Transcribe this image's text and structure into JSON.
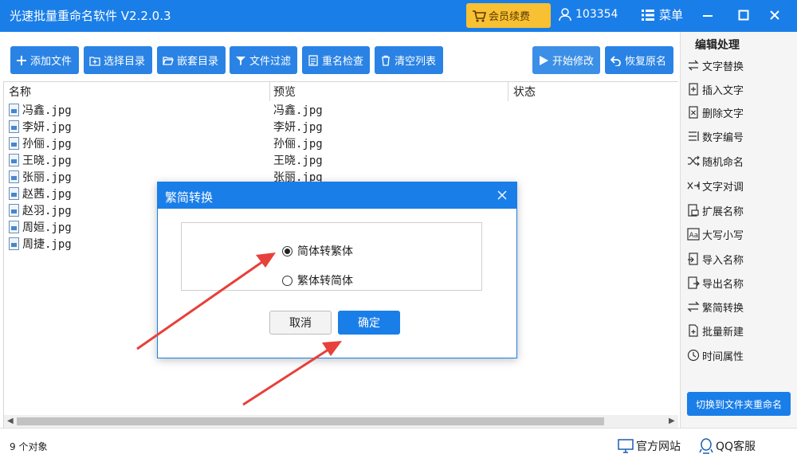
{
  "app": {
    "title": "光速批量重命名软件 V2.2.0.3"
  },
  "header": {
    "vip_label": "会员续费",
    "user_id": "103354",
    "menu_label": "菜单"
  },
  "toolbar": {
    "add_file": "添加文件",
    "select_dir": "选择目录",
    "nested_dir": "嵌套目录",
    "file_filter": "文件过滤",
    "rename_check": "重名检查",
    "clear_list": "清空列表",
    "start_modify": "开始修改",
    "restore_name": "恢复原名"
  },
  "filelist": {
    "columns": [
      "名称",
      "预览",
      "状态"
    ],
    "rows": [
      {
        "name": "冯鑫.jpg",
        "preview": "冯鑫.jpg"
      },
      {
        "name": "李妍.jpg",
        "preview": "李妍.jpg"
      },
      {
        "name": "孙俪.jpg",
        "preview": "孙俪.jpg"
      },
      {
        "name": "王晓.jpg",
        "preview": "王晓.jpg"
      },
      {
        "name": "张丽.jpg",
        "preview": "张丽.jpg"
      },
      {
        "name": "赵茜.jpg",
        "preview": ""
      },
      {
        "name": "赵羽.jpg",
        "preview": ""
      },
      {
        "name": "周姮.jpg",
        "preview": ""
      },
      {
        "name": "周捷.jpg",
        "preview": ""
      }
    ]
  },
  "status": {
    "count": "9 个对象",
    "official_site": "官方网站",
    "qq_service": "QQ客服"
  },
  "panel": {
    "title": "编辑处理",
    "items": [
      "文字替换",
      "插入文字",
      "删除文字",
      "数字编号",
      "随机命名",
      "文字对调",
      "扩展名称",
      "大写小写",
      "导入名称",
      "导出名称",
      "繁简转换",
      "批量新建",
      "时间属性"
    ],
    "switch_button": "切换到文件夹重命名"
  },
  "dialog": {
    "title": "繁简转换",
    "option_s2t": "简体转繁体",
    "option_t2s": "繁体转简体",
    "selected": "简体转繁体",
    "cancel": "取消",
    "ok": "确定"
  },
  "colors": {
    "primary": "#1a7ee8",
    "vip": "#f8c033",
    "arrow": "#e8403a"
  }
}
